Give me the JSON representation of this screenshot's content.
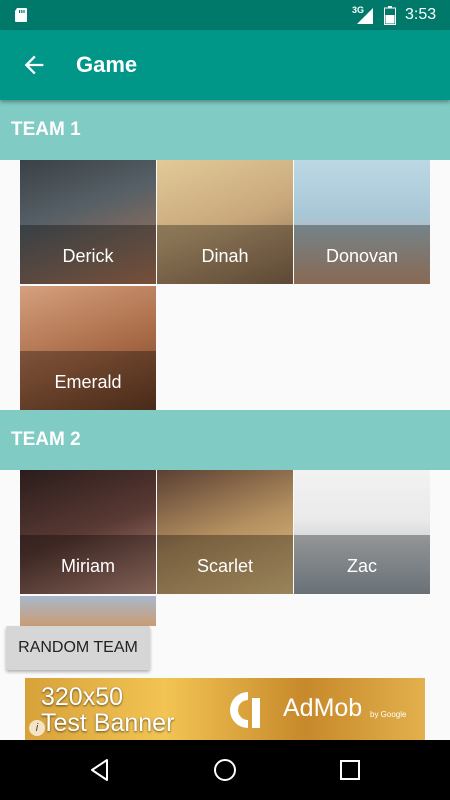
{
  "status_bar": {
    "network": "3G",
    "time": "3:53"
  },
  "app_bar": {
    "title": "Game"
  },
  "teams": [
    {
      "label": "TEAM 1",
      "players": [
        {
          "name": "Derick",
          "photo_colors": [
            "#3b4146",
            "#b07656"
          ]
        },
        {
          "name": "Dinah",
          "photo_colors": [
            "#e2c998",
            "#8a6b4f"
          ]
        },
        {
          "name": "Donovan",
          "photo_colors": [
            "#a8c7d6",
            "#c99c7c"
          ]
        },
        {
          "name": "Emerald",
          "photo_colors": [
            "#d6a07e",
            "#6b3f26"
          ]
        }
      ]
    },
    {
      "label": "TEAM 2",
      "players": [
        {
          "name": "Miriam",
          "photo_colors": [
            "#2a1c1b",
            "#c08f80"
          ]
        },
        {
          "name": "Scarlet",
          "photo_colors": [
            "#5a3f33",
            "#e3c384"
          ]
        },
        {
          "name": "Zac",
          "photo_colors": [
            "#eaeaea",
            "#9ba7b0"
          ]
        },
        {
          "name": "",
          "photo_colors": [
            "#a8b8cc",
            "#c99c74"
          ]
        }
      ]
    }
  ],
  "random_button": {
    "label": "RANDOM TEAM"
  },
  "ad_banner": {
    "line1": "320x50",
    "line2": "Test Banner",
    "brand": "AdMob",
    "sub_brand": "by Google",
    "info": "i",
    "color": "#e2b04c"
  },
  "colors": {
    "status_bar": "#00796b",
    "app_bar": "#009688",
    "team_header": "#80cbc4"
  }
}
